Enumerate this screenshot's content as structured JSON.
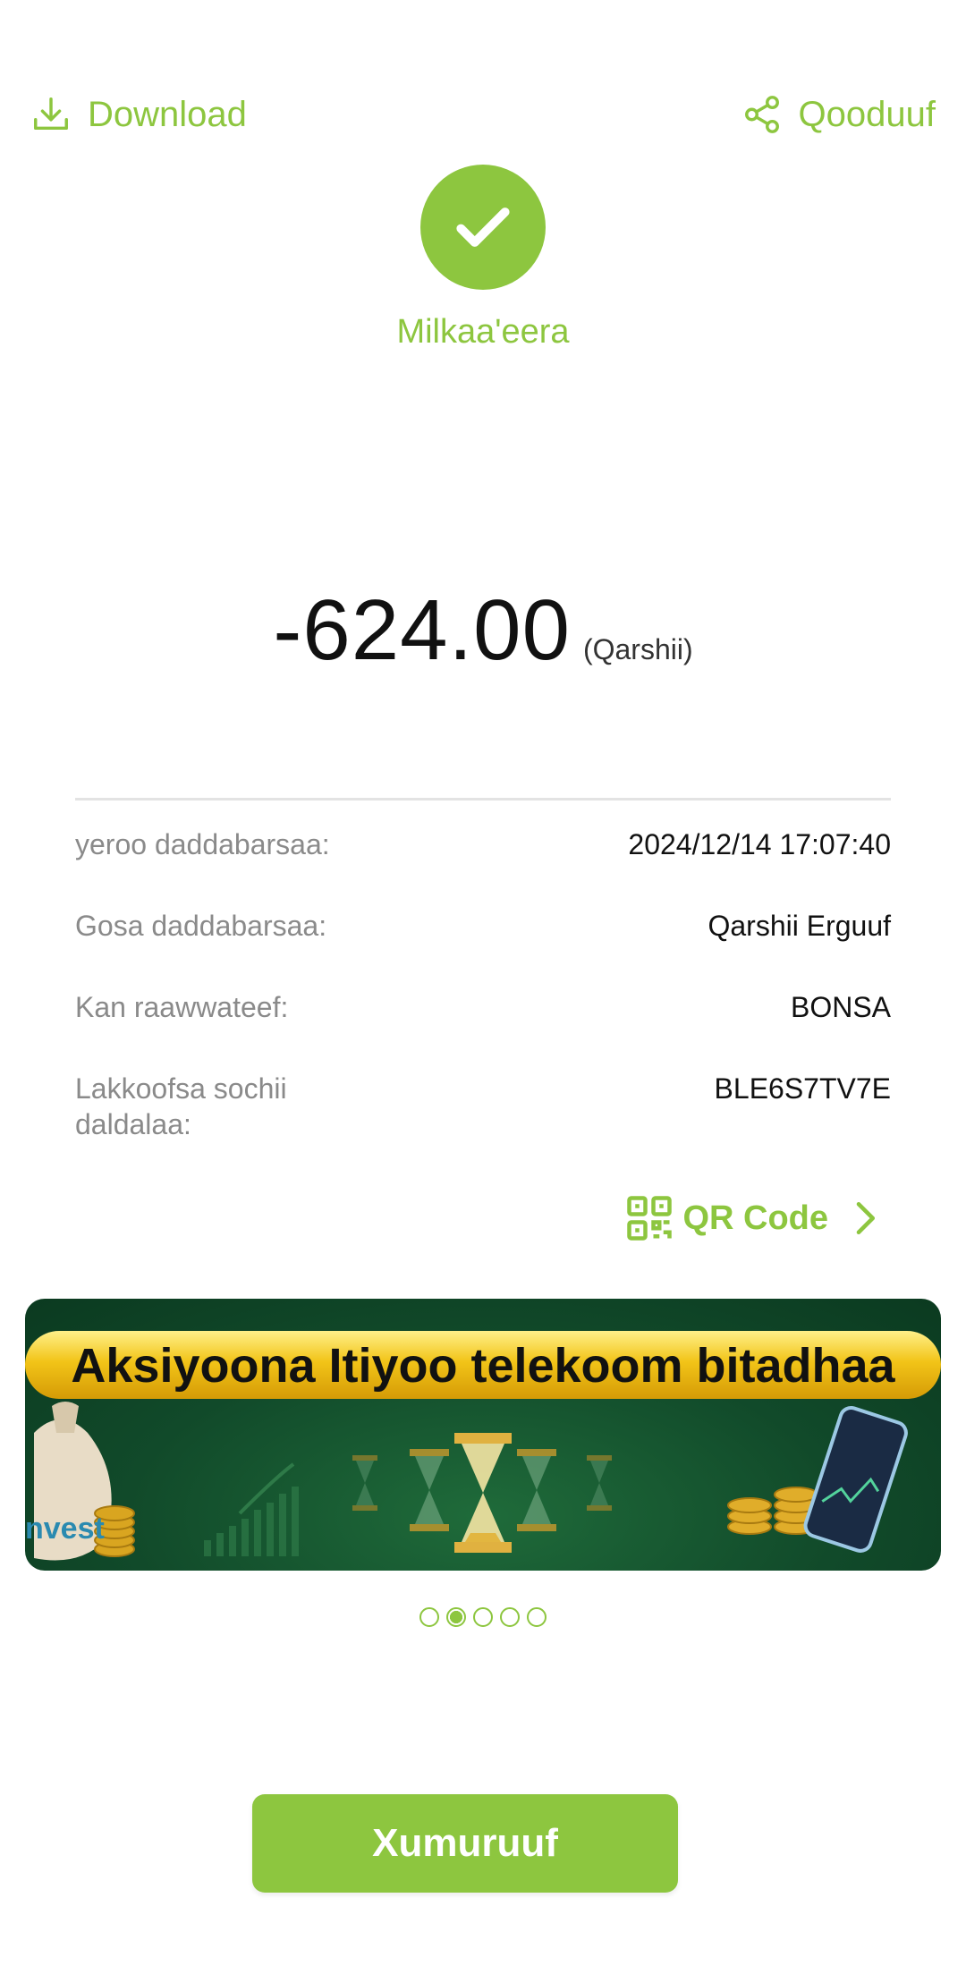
{
  "header": {
    "download_label": "Download",
    "share_label": "Qooduuf"
  },
  "status": {
    "text": "Milkaa'eera",
    "color": "#8dc63f"
  },
  "transaction": {
    "amount": "-624.00",
    "currency": "(Qarshii)"
  },
  "details": [
    {
      "label": "yeroo daddabarsaa:",
      "value": "2024/12/14 17:07:40"
    },
    {
      "label": "Gosa daddabarsaa:",
      "value": "Qarshii Erguuf"
    },
    {
      "label": "Kan raawwateef:",
      "value": "BONSA"
    },
    {
      "label": "Lakkoofsa sochii daldalaa:",
      "value": "BLE6S7TV7E"
    }
  ],
  "qr": {
    "label": "QR Code"
  },
  "banner": {
    "headline": "Aksiyoona Itiyoo telekoom bitadhaa",
    "bag_text": "nvest",
    "pagination": {
      "total": 5,
      "active_index": 1
    }
  },
  "footer": {
    "close_label": "Xumuruuf"
  },
  "theme": {
    "accent": "#8dc63f"
  }
}
